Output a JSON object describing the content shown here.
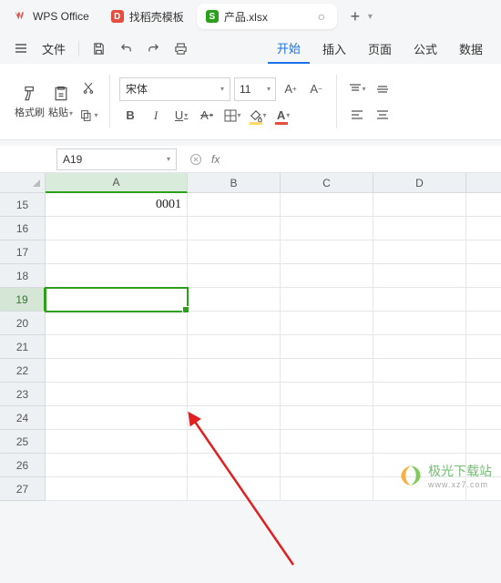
{
  "titlebar": {
    "tabs": [
      {
        "label": "WPS Office",
        "icon": "wps"
      },
      {
        "label": "找稻壳模板",
        "icon": "docer"
      },
      {
        "label": "产品.xlsx",
        "icon": "sheet",
        "active": true
      }
    ],
    "add_label": "+"
  },
  "menu": {
    "file_label": "文件",
    "tabs": [
      {
        "label": "开始",
        "active": true
      },
      {
        "label": "插入"
      },
      {
        "label": "页面"
      },
      {
        "label": "公式"
      },
      {
        "label": "数据"
      }
    ]
  },
  "ribbon": {
    "format_painter": "格式刷",
    "paste": "粘贴",
    "font_name": "宋体",
    "font_size": "11",
    "bold": "B",
    "italic": "I",
    "underline": "U",
    "strike": "A",
    "fill_color": "#ffd966",
    "font_color": "#e74c3c"
  },
  "formula_bar": {
    "name_box": "A19",
    "fx": "fx",
    "value": ""
  },
  "sheet": {
    "columns": [
      "A",
      "B",
      "C",
      "D"
    ],
    "rows": [
      15,
      16,
      17,
      18,
      19,
      20,
      21,
      22,
      23,
      24,
      25,
      26,
      27
    ],
    "selected_cell": "A19",
    "data": {
      "A15": "0001"
    }
  },
  "watermark": {
    "text": "极光下载站",
    "sub": "www.xz7.com"
  }
}
